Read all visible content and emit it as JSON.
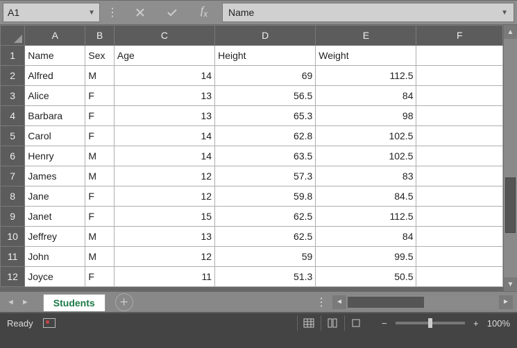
{
  "formula_bar": {
    "name_box": "A1",
    "formula_value": "Name"
  },
  "columns": [
    "A",
    "B",
    "C",
    "D",
    "E",
    "F"
  ],
  "headers": {
    "A": "Name",
    "B": "Sex",
    "C": "Age",
    "D": "Height",
    "E": "Weight"
  },
  "rows": [
    {
      "n": 1,
      "A": "Name",
      "B": "Sex",
      "C": "Age",
      "D": "Height",
      "E": "Weight"
    },
    {
      "n": 2,
      "A": "Alfred",
      "B": "M",
      "C": 14,
      "D": 69,
      "E": 112.5
    },
    {
      "n": 3,
      "A": "Alice",
      "B": "F",
      "C": 13,
      "D": 56.5,
      "E": 84
    },
    {
      "n": 4,
      "A": "Barbara",
      "B": "F",
      "C": 13,
      "D": 65.3,
      "E": 98
    },
    {
      "n": 5,
      "A": "Carol",
      "B": "F",
      "C": 14,
      "D": 62.8,
      "E": 102.5
    },
    {
      "n": 6,
      "A": "Henry",
      "B": "M",
      "C": 14,
      "D": 63.5,
      "E": 102.5
    },
    {
      "n": 7,
      "A": "James",
      "B": "M",
      "C": 12,
      "D": 57.3,
      "E": 83
    },
    {
      "n": 8,
      "A": "Jane",
      "B": "F",
      "C": 12,
      "D": 59.8,
      "E": 84.5
    },
    {
      "n": 9,
      "A": "Janet",
      "B": "F",
      "C": 15,
      "D": 62.5,
      "E": 112.5
    },
    {
      "n": 10,
      "A": "Jeffrey",
      "B": "M",
      "C": 13,
      "D": 62.5,
      "E": 84
    },
    {
      "n": 11,
      "A": "John",
      "B": "M",
      "C": 12,
      "D": 59,
      "E": 99.5
    },
    {
      "n": 12,
      "A": "Joyce",
      "B": "F",
      "C": 11,
      "D": 51.3,
      "E": 50.5
    }
  ],
  "sheet_tab": "Students",
  "status": {
    "ready": "Ready",
    "zoom": "100%"
  },
  "chart_data": {
    "type": "table",
    "title": "Students",
    "columns": [
      "Name",
      "Sex",
      "Age",
      "Height",
      "Weight"
    ],
    "rows": [
      [
        "Alfred",
        "M",
        14,
        69,
        112.5
      ],
      [
        "Alice",
        "F",
        13,
        56.5,
        84
      ],
      [
        "Barbara",
        "F",
        13,
        65.3,
        98
      ],
      [
        "Carol",
        "F",
        14,
        62.8,
        102.5
      ],
      [
        "Henry",
        "M",
        14,
        63.5,
        102.5
      ],
      [
        "James",
        "M",
        12,
        57.3,
        83
      ],
      [
        "Jane",
        "F",
        12,
        59.8,
        84.5
      ],
      [
        "Janet",
        "F",
        15,
        62.5,
        112.5
      ],
      [
        "Jeffrey",
        "M",
        13,
        62.5,
        84
      ],
      [
        "John",
        "M",
        12,
        59,
        99.5
      ],
      [
        "Joyce",
        "F",
        11,
        51.3,
        50.5
      ]
    ]
  }
}
